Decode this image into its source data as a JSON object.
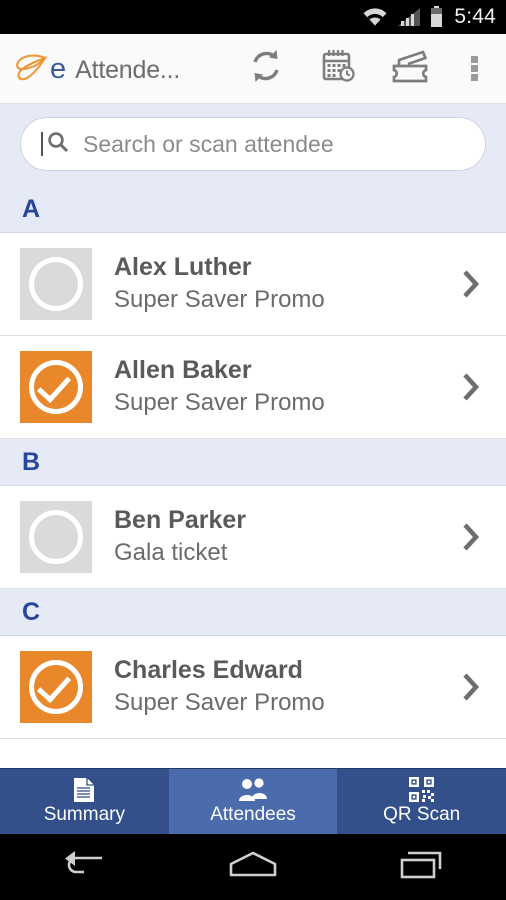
{
  "status_bar": {
    "time": "5:44",
    "icons": [
      "wifi-icon",
      "cellular-signal-icon",
      "battery-icon"
    ]
  },
  "app_bar": {
    "brand_letter": "e",
    "title": "Attende...",
    "logo_name": "butterfly-logo",
    "actions": [
      {
        "name": "sync-button",
        "icon": "refresh-icon"
      },
      {
        "name": "event-date-button",
        "icon": "calendar-clock-icon"
      },
      {
        "name": "tickets-button",
        "icon": "ticket-icon"
      },
      {
        "name": "overflow-menu-button",
        "icon": "more-vertical-icon"
      }
    ]
  },
  "search": {
    "placeholder": "Search or scan attendee",
    "value": "",
    "icon": "search-icon"
  },
  "sections": [
    {
      "letter": "A",
      "rows": [
        {
          "name": "Alex Luther",
          "ticket": "Super Saver Promo",
          "checked": false
        },
        {
          "name": "Allen Baker",
          "ticket": "Super Saver Promo",
          "checked": true
        }
      ]
    },
    {
      "letter": "B",
      "rows": [
        {
          "name": "Ben Parker",
          "ticket": "Gala ticket",
          "checked": false
        }
      ]
    },
    {
      "letter": "C",
      "rows": [
        {
          "name": "Charles Edward",
          "ticket": "Super Saver Promo",
          "checked": true
        }
      ]
    }
  ],
  "tabs": [
    {
      "label": "Summary",
      "icon": "document-icon",
      "active": false
    },
    {
      "label": "Attendees",
      "icon": "people-icon",
      "active": true
    },
    {
      "label": "QR Scan",
      "icon": "qr-code-icon",
      "active": false
    }
  ],
  "nav_bar": {
    "back": "back-icon",
    "home": "home-icon",
    "recents": "recents-icon"
  },
  "colors": {
    "accent_orange": "#e8882b",
    "section_header_bg": "#e6eaf7",
    "section_letter": "#27479b",
    "tab_bar_bg": "#33508a",
    "tab_active_bg": "#4a6cad",
    "brand_blue": "#3a5c9e",
    "app_bar_bg": "#fafafa"
  }
}
